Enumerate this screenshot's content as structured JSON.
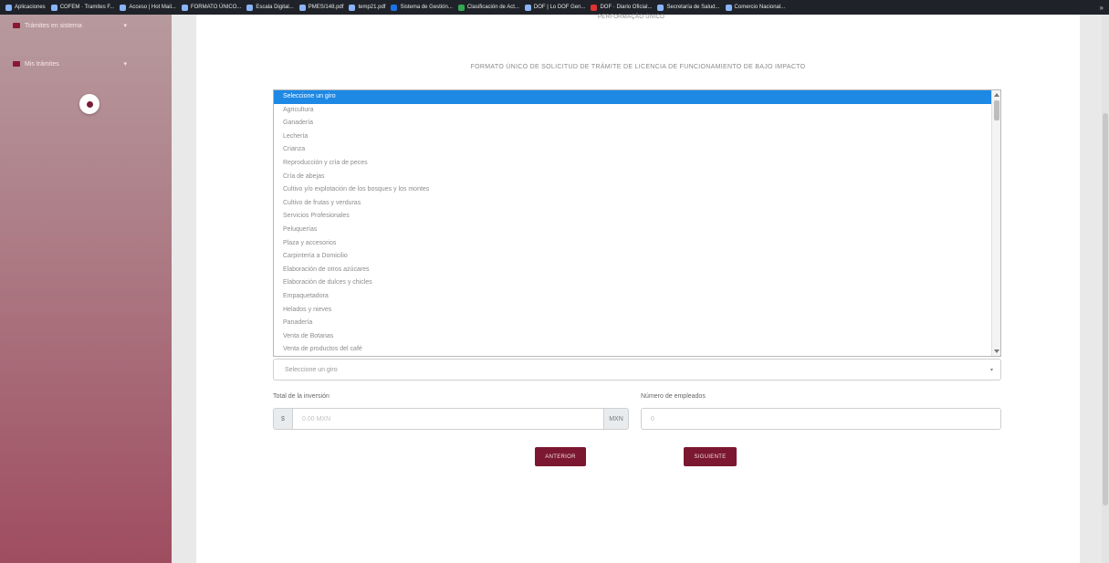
{
  "bookmarks": [
    {
      "label": "Aplicaciones",
      "color": "#8ab4f8"
    },
    {
      "label": "COFEM · Tramites F...",
      "color": "#8ab4f8"
    },
    {
      "label": "Acceso | Hot Mail...",
      "color": "#8ab4f8"
    },
    {
      "label": "FORMATO ÚNICO...",
      "color": "#8ab4f8"
    },
    {
      "label": "Escala Digital...",
      "color": "#8ab4f8"
    },
    {
      "label": "PMES/148.pdf",
      "color": "#8ab4f8"
    },
    {
      "label": "temp21.pdf",
      "color": "#8ab4f8"
    },
    {
      "label": "Sistema de Gestión...",
      "color": "#1a73e8"
    },
    {
      "label": "Clasificación de Act...",
      "color": "#34a853"
    },
    {
      "label": "DOF | Lo DOF Gen...",
      "color": "#8ab4f8"
    },
    {
      "label": "DOF · Diario Oficial...",
      "color": "#d33"
    },
    {
      "label": "Secretaría de Salud...",
      "color": "#8ab4f8"
    },
    {
      "label": "Comercio Nacional...",
      "color": "#8ab4f8"
    }
  ],
  "sidebar": {
    "items": [
      {
        "label": "Trámites en sistema"
      },
      {
        "label": "Mis trámites"
      }
    ]
  },
  "page": {
    "top_title": "PERFORMAÇÃO ÚNICO",
    "form_title": "FORMATO ÚNICO DE SOLICITUD DE TRÁMITE DE LICENCIA DE FUNCIONAMIENTO DE BAJO IMPACTO"
  },
  "giro_list": {
    "options": [
      "Seleccione un giro",
      "Agricultura",
      "Ganadería",
      "Lechería",
      "Crianza",
      "Reproducción y cría de peces",
      "Cría de abejas",
      "Cultivo y/o explotación de los bosques y los montes",
      "Cultivo de frutas y verduras",
      "Servicios Profesionales",
      "Peluquerías",
      "Plaza y accesorios",
      "Carpintería a Domicilio",
      "Elaboración de otros azúcares",
      "Elaboración de dulces y chicles",
      "Empaquetadora",
      "Helados y nieves",
      "Panadería",
      "Venta de Botanas",
      "Venta de productos del café"
    ],
    "selected_index": 0
  },
  "giro_select": {
    "value": "Seleccione un giro"
  },
  "inversion": {
    "label": "Total de la inversión",
    "prefix": "$",
    "placeholder": "0.00 MXN",
    "suffix": "MXN"
  },
  "empleados": {
    "label": "Número de empleados",
    "placeholder": "0"
  },
  "buttons": {
    "prev": "ANTERIOR",
    "next": "SIGUIENTE"
  },
  "colors": {
    "accent": "#7b1730",
    "selection": "#1e88e5"
  }
}
